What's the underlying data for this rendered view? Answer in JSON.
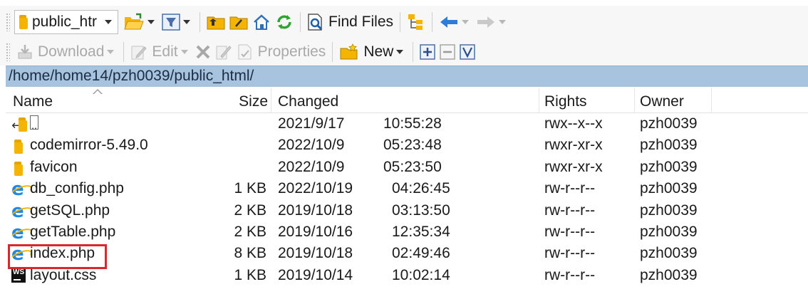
{
  "toolbar1": {
    "path_combo": "public_htr",
    "find_files_label": "Find Files"
  },
  "toolbar2": {
    "download_label": "Download",
    "edit_label": "Edit",
    "properties_label": "Properties",
    "new_label": "New"
  },
  "address": "/home/home14/pzh0039/public_html/",
  "columns": {
    "name": "Name",
    "size": "Size",
    "changed": "Changed",
    "rights": "Rights",
    "owner": "Owner"
  },
  "files": [
    {
      "name": "..",
      "icon": "parent-folder-icon",
      "size": "",
      "date": "2021/9/17",
      "time": "10:55:28",
      "rights": "rwx--x--x",
      "owner": "pzh0039"
    },
    {
      "name": "codemirror-5.49.0",
      "icon": "folder-icon",
      "size": "",
      "date": "2022/10/9",
      "time": "05:23:48",
      "rights": "rwxr-xr-x",
      "owner": "pzh0039"
    },
    {
      "name": "favicon",
      "icon": "folder-icon",
      "size": "",
      "date": "2022/10/9",
      "time": "05:23:50",
      "rights": "rwxr-xr-x",
      "owner": "pzh0039"
    },
    {
      "name": "db_config.php",
      "icon": "ie-file-icon",
      "size": "1 KB",
      "date": "2022/10/19",
      "time": "04:26:45",
      "rights": "rw-r--r--",
      "owner": "pzh0039"
    },
    {
      "name": "getSQL.php",
      "icon": "ie-file-icon",
      "size": "2 KB",
      "date": "2019/10/18",
      "time": "03:13:50",
      "rights": "rw-r--r--",
      "owner": "pzh0039"
    },
    {
      "name": "getTable.php",
      "icon": "ie-file-icon",
      "size": "2 KB",
      "date": "2019/10/16",
      "time": "12:35:34",
      "rights": "rw-r--r--",
      "owner": "pzh0039"
    },
    {
      "name": "index.php",
      "icon": "ie-file-icon",
      "size": "8 KB",
      "date": "2019/10/18",
      "time": "02:49:46",
      "rights": "rw-r--r--",
      "owner": "pzh0039"
    },
    {
      "name": "layout.css",
      "icon": "webstorm-file-icon",
      "size": "1 KB",
      "date": "2019/10/14",
      "time": "10:02:14",
      "rights": "rw-r--r--",
      "owner": "pzh0039"
    }
  ],
  "colors": {
    "address_bar": "#a7c3dd",
    "highlight": "#d8272d",
    "folder": "#f4b400"
  }
}
